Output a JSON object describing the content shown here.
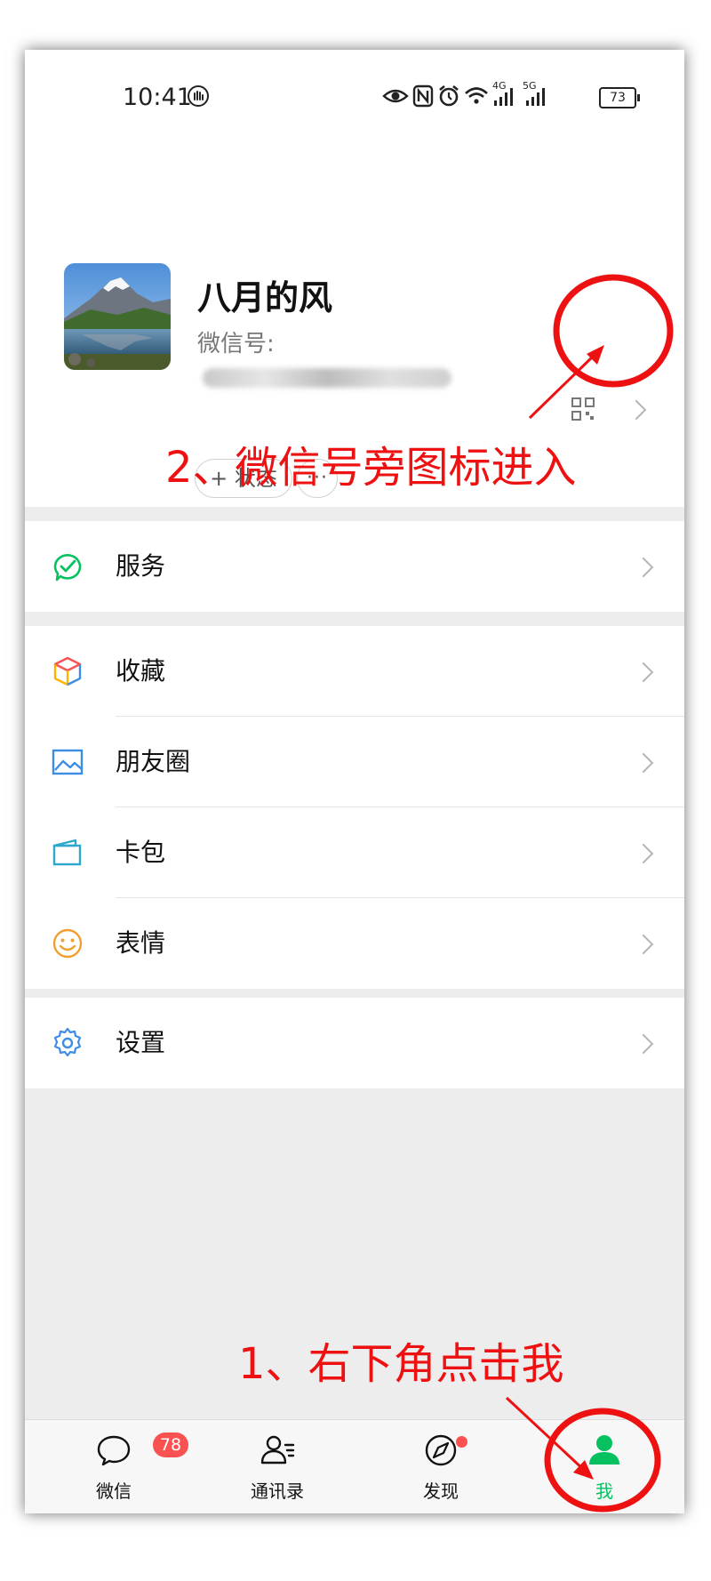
{
  "status_bar": {
    "time": "10:41",
    "battery": "73",
    "net1": "4G",
    "net2": "5G"
  },
  "profile": {
    "nickname": "八月的风",
    "wechat_id_label": "微信号:",
    "status_button": "+ 状态",
    "more_button": "···"
  },
  "menu": {
    "services": "服务",
    "favorites": "收藏",
    "moments": "朋友圈",
    "cards": "卡包",
    "stickers": "表情",
    "settings": "设置"
  },
  "tabbar": {
    "chats": "微信",
    "chats_badge": "78",
    "contacts": "通讯录",
    "discover": "发现",
    "me": "我"
  },
  "annotations": {
    "step1": "1、右下角点击我",
    "step2": "2、微信号旁图标进入"
  },
  "colors": {
    "wechat_green": "#07c160",
    "annotation_red": "#ee1111",
    "badge_red": "#fa5151"
  }
}
